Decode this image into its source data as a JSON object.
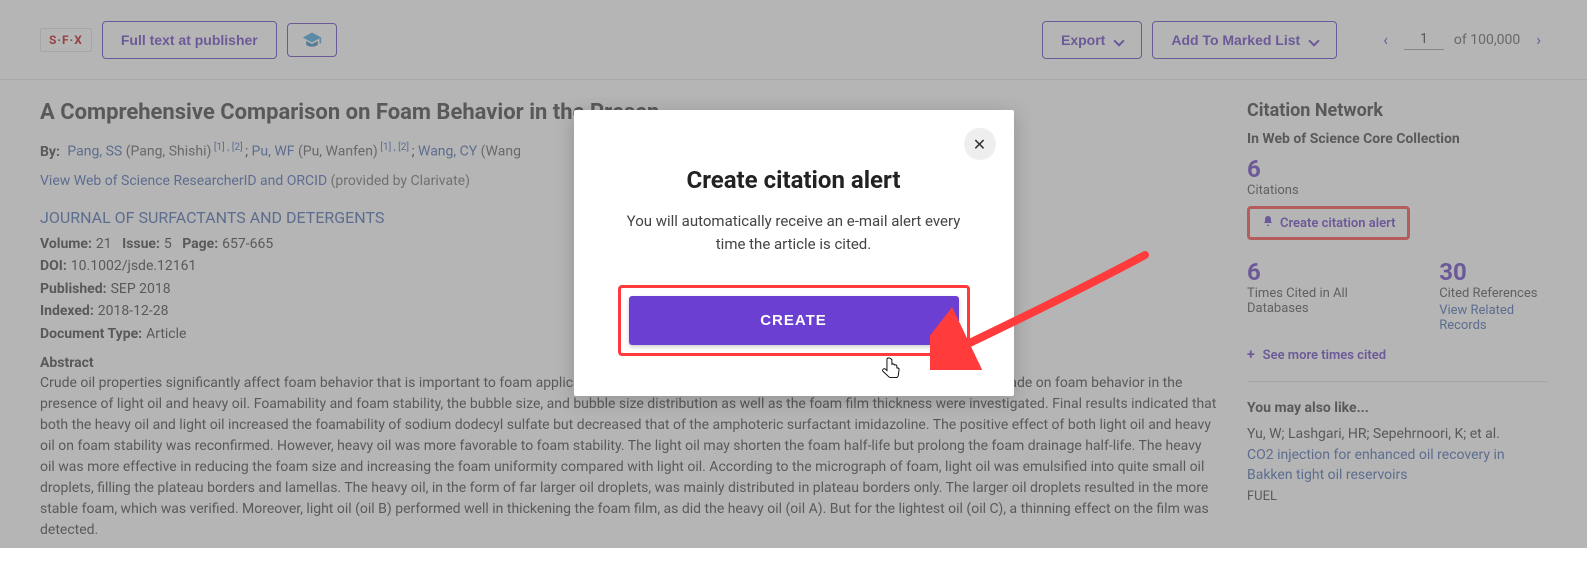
{
  "toolbar": {
    "sfx_label": "S·F·X",
    "fulltext_label": "Full text at publisher",
    "export_label": "Export",
    "marked_label": "Add To Marked List",
    "page_current": "1",
    "page_of_label": "of",
    "page_total": "100,000"
  },
  "article": {
    "title": "A Comprehensive Comparison on Foam Behavior in the Presen",
    "by_label": "By:",
    "authors": [
      {
        "link": "Pang, SS",
        "paren": " (Pang, Shishi)",
        "sup": " [1] , [2] "
      },
      {
        "link": "Pu, WF",
        "paren": " (Pu, Wanfen)",
        "sup": " [1] , [2] "
      },
      {
        "link": "Wang, CY",
        "paren": " (Wang",
        "sup": ""
      }
    ],
    "orcid_link": "View Web of Science ResearcherID and ORCID",
    "provided": "(provided by Clarivate)",
    "journal": "JOURNAL OF SURFACTANTS AND DETERGENTS",
    "vol_label": "Volume:",
    "vol_val": "21",
    "issue_label": "Issue:",
    "issue_val": "5",
    "page_label": "Page:",
    "page_val": "657-665",
    "doi_label": "DOI:",
    "doi_val": "10.1002/jsde.12161",
    "pub_label": "Published:",
    "pub_val": "SEP 2018",
    "idx_label": "Indexed:",
    "idx_val": "2018-12-28",
    "type_label": "Document Type:",
    "type_val": "Article",
    "abstract_label": "Abstract",
    "abstract_text": "Crude oil properties significantly affect foam behavior that is important to foam application in oil recovery. In this study, a comprehensive comparison was made on foam behavior in the presence of light oil and heavy oil. Foamability and foam stability, the bubble size, and bubble size distribution as well as the foam film thickness were investigated. Final results indicated that both the heavy oil and light oil increased the foamability of sodium dodecyl sulfate but decreased that of the amphoteric surfactant imidazoline. The positive effect of both light oil and heavy oil on foam stability was reconfirmed. However, heavy oil was more favorable to foam stability. The light oil may shorten the foam half-life but prolong the foam drainage half-life. The heavy oil was more effective in reducing the foam size and increasing the foam uniformity compared with light oil. According to the micrograph of foam, light oil was emulsified into quite small oil droplets, filling the plateau borders and lamellas. The heavy oil, in the form of far larger oil droplets, was mainly distributed in plateau borders only. The larger oil droplets resulted in the more stable foam, which was verified. Moreover, light oil (oil B) performed well in thickening the foam film, as did the heavy oil (oil A). But for the lightest oil (oil C), a thinning effect on the film was detected."
  },
  "sidebar": {
    "heading": "Citation Network",
    "collection": "In Web of Science Core Collection",
    "citations_num": "6",
    "citations_label": "Citations",
    "alert_label": "Create citation alert",
    "times_num": "6",
    "times_label": "Times Cited in All Databases",
    "refs_num": "30",
    "refs_label": "Cited References",
    "related_link": "View Related Records",
    "see_more": "See more times cited",
    "like_heading": "You may also like...",
    "rec_authors": "Yu, W; Lashgari, HR; Sepehrnoori, K; et al.",
    "rec_title": "CO2 injection for enhanced oil recovery in Bakken tight oil reservoirs",
    "rec_source": "FUEL"
  },
  "modal": {
    "title": "Create citation alert",
    "body": "You will automatically receive an e-mail alert every time the article is cited.",
    "create_label": "CREATE"
  }
}
